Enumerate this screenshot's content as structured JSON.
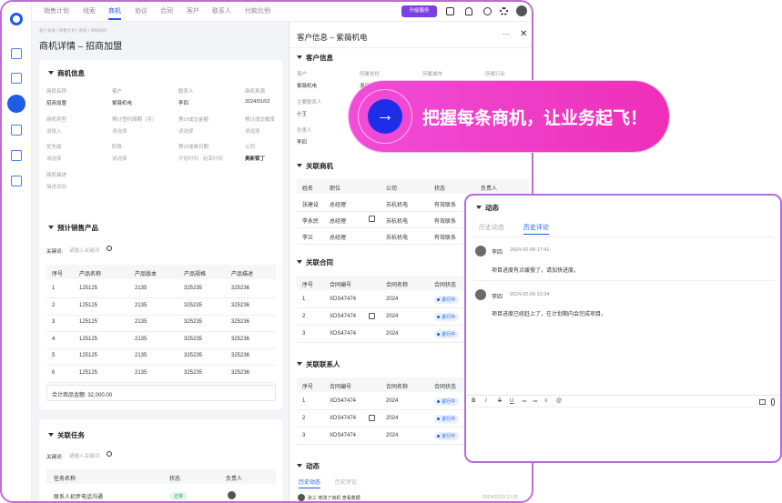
{
  "topnav": {
    "items": [
      "销售计划",
      "线索",
      "商机",
      "协议",
      "合同",
      "客户",
      "联系人",
      "付款比例"
    ],
    "active": 2,
    "upgrade": "升级服务"
  },
  "left": {
    "breadcrumb": "客户关系 / 销售计划 / 商机 / 项目商机",
    "title": "商机详情 – 招商加盟",
    "info": {
      "title": "商机信息",
      "fields": [
        {
          "label": "商机名称",
          "value": "招商加盟"
        },
        {
          "label": "客户",
          "value": "紫薇机电"
        },
        {
          "label": "联系人",
          "value": "李四"
        },
        {
          "label": "商机来源",
          "value": "2024/01/02"
        },
        {
          "label": "商机类型",
          "value": "请输入"
        },
        {
          "label": "预计签约周期（月）",
          "value": "请选择"
        },
        {
          "label": "预计成交金额",
          "value": "请选择"
        },
        {
          "label": "预计成交概率",
          "value": "请选择"
        },
        {
          "label": "优先级",
          "value": "请选择"
        },
        {
          "label": "阶段",
          "value": "请选择"
        },
        {
          "label": "预计成单日期",
          "value": "开始时间 - 结束时间"
        },
        {
          "label": "公司",
          "value": "奥新钡丁"
        }
      ],
      "desc_label": "商机描述",
      "desc_value": "描述添加"
    },
    "products": {
      "title": "预计销售产品",
      "keyword_label": "关键词:",
      "keyword_placeholder": "请输入关键词",
      "columns": [
        "序号",
        "产品名称",
        "产品版本",
        "产品规格",
        "产品描述"
      ],
      "rows": [
        [
          "1",
          "125125",
          "2135",
          "325235",
          "325236"
        ],
        [
          "2",
          "125125",
          "2135",
          "325235",
          "325236"
        ],
        [
          "3",
          "125125",
          "2135",
          "325235",
          "325236"
        ],
        [
          "4",
          "125125",
          "2135",
          "325235",
          "325236"
        ],
        [
          "5",
          "125125",
          "2135",
          "325235",
          "325236"
        ],
        [
          "6",
          "125125",
          "2135",
          "325235",
          "325236"
        ]
      ],
      "total": "合计商品金额: 32,000.00"
    },
    "tasks": {
      "title": "关联任务",
      "keyword_label": "关键词:",
      "keyword_placeholder": "请输入关键词",
      "columns": [
        "任务名称",
        "状态",
        "负责人"
      ],
      "row": {
        "name": "联系人初步电话沟通",
        "status": "正常"
      }
    }
  },
  "right": {
    "title": "客户信息 – 紫薇机电",
    "customer": {
      "title": "客户信息",
      "labels": [
        "客户",
        "所属省份",
        "所属城市",
        "所属行业"
      ],
      "values": [
        "紫薇机电",
        "浙江",
        "",
        ""
      ],
      "contact_label": "主要联系人",
      "contact": "小王",
      "owner_label": "负责人",
      "owner": "李四"
    },
    "opps": {
      "title": "关联商机",
      "columns": [
        "姓名",
        "职位",
        "公司",
        "状态",
        "负责人"
      ],
      "rows": [
        [
          "张建设",
          "总经理",
          "苏杭机电",
          "有效联系"
        ],
        [
          "李永民",
          "总经理",
          "苏杭机电",
          "有效联系"
        ],
        [
          "李兰",
          "总经理",
          "苏杭机电",
          "有效联系"
        ]
      ]
    },
    "contracts": {
      "title": "关联合同",
      "columns": [
        "序号",
        "合同编号",
        "合同名称",
        "合同状态"
      ],
      "rows": [
        [
          "1",
          "XDS47474",
          "2024",
          "进行中"
        ],
        [
          "2",
          "XDS47474",
          "2024",
          "进行中"
        ],
        [
          "3",
          "XDS47474",
          "2024",
          "进行中"
        ]
      ]
    },
    "contacts": {
      "title": "关联联系人",
      "columns": [
        "序号",
        "合同编号",
        "合同名称",
        "合同状态"
      ],
      "rows": [
        [
          "1",
          "XDS47474",
          "2024",
          "进行中"
        ],
        [
          "2",
          "XDS47474",
          "2024",
          "进行中"
        ],
        [
          "3",
          "XDS47474",
          "2024",
          "进行中"
        ]
      ]
    },
    "activity": {
      "title": "动态",
      "tabs": [
        "历史动态",
        "历史评论"
      ],
      "item": "张三 修改了商机 查看数据",
      "time": "2024/01/23 12:35"
    }
  },
  "banner": {
    "text": "把握每条商机，让业务起飞！"
  },
  "dynamic": {
    "title": "动态",
    "tabs": [
      "历史动态",
      "历史评论"
    ],
    "active_tab": 1,
    "comments": [
      {
        "user": "李四",
        "time": "2024-02-08 17:41",
        "text": "项目进度有点缓慢了，请加快进度。"
      },
      {
        "user": "李四",
        "time": "2024-02-09 12:34",
        "text": "项目进度已经赶上了，在计划期内会完成项目。"
      }
    ],
    "toolbar": [
      "B",
      "I",
      "S",
      "U",
      "≔",
      "≔",
      "≡",
      "@"
    ]
  }
}
